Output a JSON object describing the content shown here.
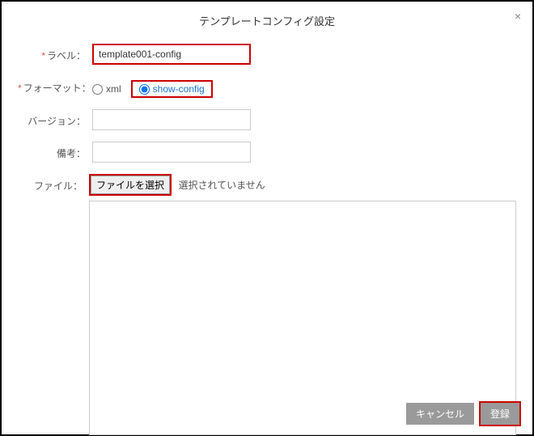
{
  "dialog": {
    "title": "テンプレートコンフィグ設定",
    "close": "×"
  },
  "form": {
    "label": {
      "label": "ラベル：",
      "required": true,
      "value": "template001-config"
    },
    "format": {
      "label": "フォーマット：",
      "required": true,
      "options": {
        "xml": "xml",
        "showConfig": "show-config"
      },
      "selected": "show-config"
    },
    "version": {
      "label": "バージョン：",
      "value": ""
    },
    "remarks": {
      "label": "備考：",
      "value": ""
    },
    "file": {
      "label": "ファイル：",
      "button": "ファイルを選択",
      "status": "選択されていません",
      "content": ""
    }
  },
  "footer": {
    "cancel": "キャンセル",
    "submit": "登録"
  }
}
